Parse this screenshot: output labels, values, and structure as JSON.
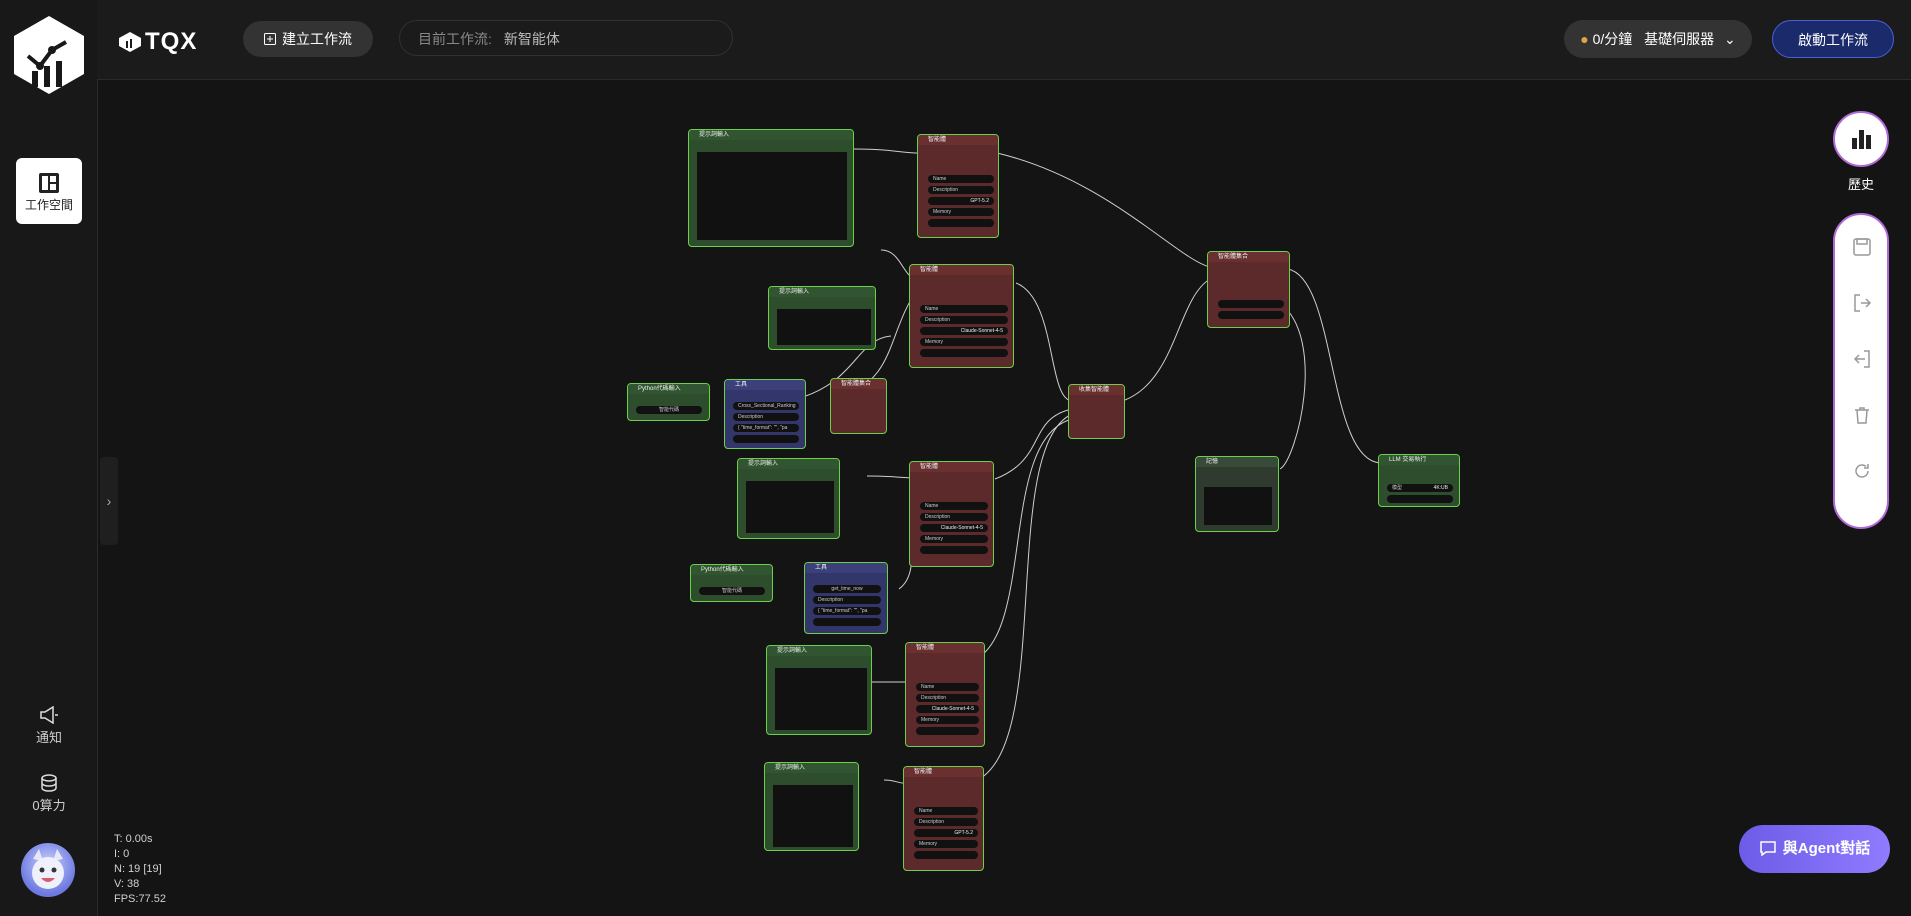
{
  "topbar": {
    "brand": "TQX",
    "new_flow_label": "建立工作流",
    "current_flow_label": "目前工作流:",
    "current_flow_value": "新智能体",
    "server_rate": "0/分鐘",
    "server_name": "基礎伺服器",
    "start_label": "啟動工作流"
  },
  "sidebar": {
    "workspace_label": "工作空間",
    "notify_label": "通知",
    "compute_label": "0算力"
  },
  "right": {
    "history_label": "歷史"
  },
  "agent_chat_label": "與Agent對話",
  "stats": {
    "t": "T: 0.00s",
    "i": "I: 0",
    "n": "N: 19 [19]",
    "v": "V: 38",
    "fps": "FPS:77.52"
  },
  "nodes": {
    "prompt_input": "提示詞輸入",
    "agent": "智能體",
    "agent_set": "智能體集合",
    "tool_set": "智能體集合",
    "collector": "收集智能體",
    "tool": "工具",
    "python_input": "Python代碼輸入",
    "python_btn": "智能代碼",
    "llm": "LLM 交易執行",
    "memory": "記憶",
    "name_label": "Name",
    "desc_label": "Description",
    "memory_label": "Memory",
    "model_gpt": "GPT-5.2",
    "model_claude": "Claude-Sonnet-4-5",
    "func_cross": "Cross_Sectional_Ranking",
    "func_time": "get_time_now",
    "code_snip": "{ \"time_format\": \"\", \"pa",
    "model_label": "模型",
    "llm_model": "4K:UB"
  },
  "colors": {
    "accent": "#6d5ce7",
    "node_border": "#6bd14a",
    "agent_node": "#5c2a2a",
    "prompt_node": "#2d4d2d",
    "tool_node": "#33366a"
  }
}
